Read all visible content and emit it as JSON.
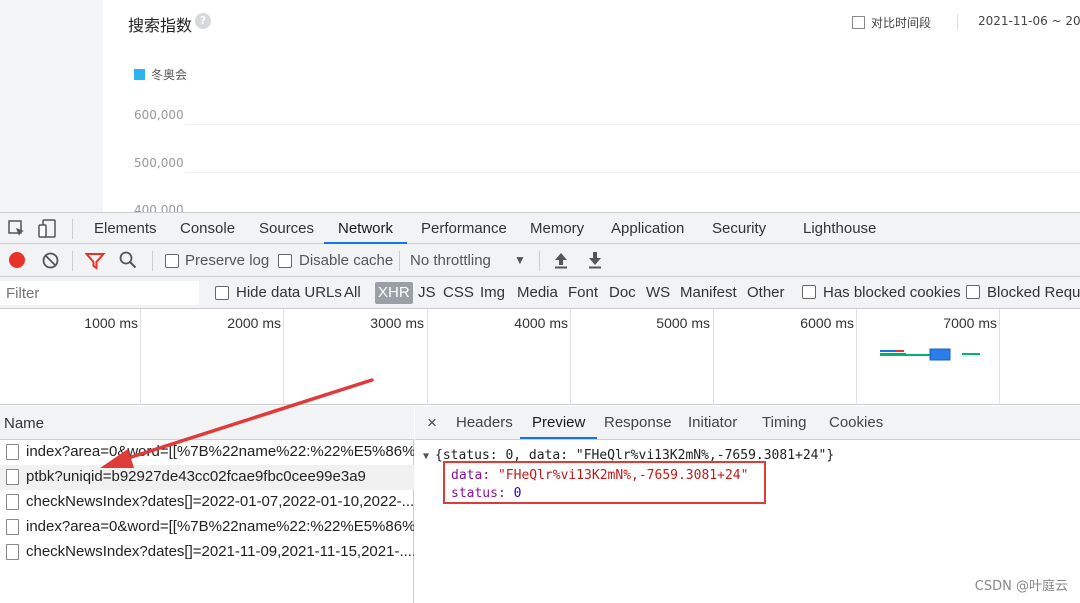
{
  "webpage": {
    "title": "搜索指数",
    "help_icon": "?",
    "compare_label": "对比时间段",
    "date_range": "2021-11-06 ~ 20",
    "legend_label": "冬奥会",
    "legend_color": "#2bb5f0",
    "y_ticks": [
      "600,000",
      "500,000",
      "400,000"
    ]
  },
  "devtools": {
    "tabs": [
      "Elements",
      "Console",
      "Sources",
      "Network",
      "Performance",
      "Memory",
      "Application",
      "Security",
      "Lighthouse"
    ],
    "active_tab": "Network",
    "toolbar": {
      "preserve_log": "Preserve log",
      "disable_cache": "Disable cache",
      "throttling": "No throttling",
      "throttling_arrow": "▼"
    },
    "filter": {
      "placeholder": "Filter",
      "hide_data_urls": "Hide data URLs",
      "types": [
        "All",
        "XHR",
        "JS",
        "CSS",
        "Img",
        "Media",
        "Font",
        "Doc",
        "WS",
        "Manifest",
        "Other"
      ],
      "active_type": "XHR",
      "has_blocked_cookies": "Has blocked cookies",
      "blocked_requests": "Blocked Reque"
    },
    "overview": {
      "labels": [
        "1000 ms",
        "2000 ms",
        "3000 ms",
        "4000 ms",
        "5000 ms",
        "6000 ms",
        "7000 ms"
      ]
    },
    "requests": {
      "header": "Name",
      "items": [
        "index?area=0&word=[[%7B%22name%22:%22%E5%86%...",
        "ptbk?uniqid=b92927de43cc02fcae9fbc0cee99e3a9",
        "checkNewsIndex?dates[]=2022-01-07,2022-01-10,2022-......",
        "index?area=0&word=[[%7B%22name%22:%22%E5%86%...",
        "checkNewsIndex?dates[]=2021-11-09,2021-11-15,2021-......"
      ],
      "selected_index": 1
    },
    "detail": {
      "close": "×",
      "tabs": [
        "Headers",
        "Preview",
        "Response",
        "Initiator",
        "Timing",
        "Cookies"
      ],
      "active_tab": "Preview",
      "summary_arrow": "▼",
      "summary": "{status: 0, data: \"FHeQlr%vi13K2mN%,-7659.3081+24\"}",
      "data_key": "data",
      "data_value": "\"FHeQlr%vi13K2mN%,-7659.3081+24\"",
      "status_key": "status",
      "status_value": "0"
    }
  },
  "watermark": "CSDN @叶庭云",
  "colors": {
    "accent": "#1a73e8",
    "annotation": "#e03b3b",
    "record": "#e8322c"
  }
}
